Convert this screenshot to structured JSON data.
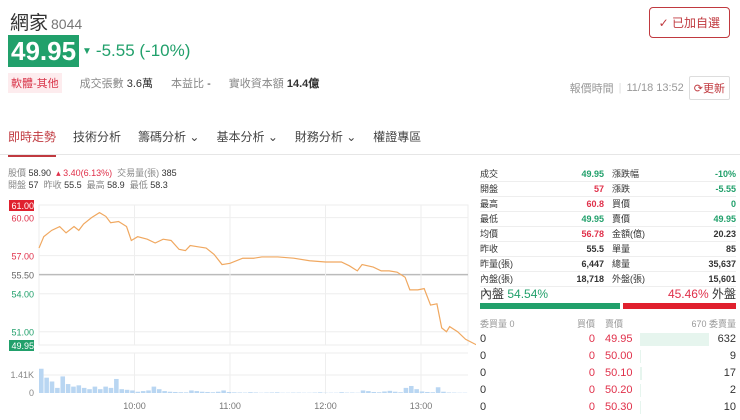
{
  "stock": {
    "name": "網家",
    "code": "8044",
    "price": "49.95",
    "change": "-5.55 (-10%)",
    "category": "軟體-其他",
    "stats": [
      {
        "label": "成交張數",
        "value": "3.6萬"
      },
      {
        "label": "本益比",
        "value": "-"
      },
      {
        "label": "實收資本額",
        "value": "14.4億"
      }
    ]
  },
  "header": {
    "favorite_label": "已加自選",
    "quote_time_label": "報價時間",
    "quote_time": "11/18 13:52",
    "refresh_label": "更新"
  },
  "tabs": [
    "即時走勢",
    "技術分析",
    "籌碼分析",
    "基本分析",
    "財務分析",
    "權證專區"
  ],
  "info": {
    "price_label": "股價",
    "price": "58.90",
    "change": "3.40(6.13%)",
    "vol_label": "交易量(張)",
    "vol": "385",
    "open_label": "開盤",
    "open": "57",
    "prev_label": "昨收",
    "prev": "55.5",
    "high_label": "最高",
    "high": "58.9",
    "low_label": "最低",
    "low": "58.3"
  },
  "table": [
    [
      {
        "l": "成交",
        "v": "49.95",
        "c": "green"
      },
      {
        "l": "漲跌幅",
        "v": "-10%",
        "c": "green"
      }
    ],
    [
      {
        "l": "開盤",
        "v": "57",
        "c": "red"
      },
      {
        "l": "漲跌",
        "v": "-5.55",
        "c": "green"
      }
    ],
    [
      {
        "l": "最高",
        "v": "60.8",
        "c": "red"
      },
      {
        "l": "買價",
        "v": "0",
        "c": "green"
      }
    ],
    [
      {
        "l": "最低",
        "v": "49.95",
        "c": "green"
      },
      {
        "l": "賣價",
        "v": "49.95",
        "c": "green"
      }
    ],
    [
      {
        "l": "均價",
        "v": "56.78",
        "c": "red"
      },
      {
        "l": "金額(億)",
        "v": "20.23",
        "c": ""
      }
    ],
    [
      {
        "l": "昨收",
        "v": "55.5",
        "c": ""
      },
      {
        "l": "單量",
        "v": "85",
        "c": ""
      }
    ],
    [
      {
        "l": "昨量(張)",
        "v": "6,447",
        "c": ""
      },
      {
        "l": "總量",
        "v": "35,637",
        "c": ""
      }
    ],
    [
      {
        "l": "內盤(張)",
        "v": "18,718",
        "c": ""
      },
      {
        "l": "外盤(張)",
        "v": "15,601",
        "c": ""
      }
    ]
  ],
  "ratio": {
    "inner_label": "內盤",
    "inner": "54.54%",
    "outer": "45.46%",
    "outer_label": "外盤",
    "inner_frac": 0.5454
  },
  "orderbook": {
    "bid_vol_header": "委買量 0",
    "bid_header": "買價",
    "ask_header": "賣價",
    "ask_vol_header": "670 委賣量",
    "rows": [
      [
        "0",
        "0",
        "49.95",
        "632"
      ],
      [
        "0",
        "0",
        "50.00",
        "9"
      ],
      [
        "0",
        "0",
        "50.10",
        "17"
      ],
      [
        "0",
        "0",
        "50.20",
        "2"
      ],
      [
        "0",
        "0",
        "50.30",
        "10"
      ]
    ]
  },
  "chart_data": {
    "type": "line",
    "ylim": [
      49.95,
      61.0
    ],
    "prev_close": 55.5,
    "y_ticks": [
      "61.00",
      "60.00",
      "57.00",
      "55.50",
      "54.00",
      "51.00",
      "49.95"
    ],
    "y_tick_values": [
      61,
      60,
      57,
      55.5,
      54,
      51,
      49.95
    ],
    "x_ticks": [
      "10:00",
      "11:00",
      "12:00",
      "13:00"
    ],
    "x_tick_minutes": [
      60,
      120,
      180,
      240
    ],
    "minutes": [
      0,
      3,
      8,
      13,
      17,
      22,
      25,
      28,
      33,
      38,
      42,
      45,
      50,
      55,
      58,
      62,
      68,
      73,
      78,
      83,
      88,
      92,
      95,
      100,
      105,
      110,
      115,
      120,
      128,
      135,
      140,
      145,
      150,
      160,
      170,
      180,
      190,
      195,
      200,
      203,
      210,
      215,
      220,
      225,
      230,
      233,
      238,
      242,
      246,
      250,
      253,
      256,
      258,
      263,
      268,
      275,
      300
    ],
    "prices": [
      57.6,
      58.5,
      59.0,
      59.3,
      58.8,
      59.3,
      59.0,
      59.5,
      60.0,
      60.4,
      60.1,
      59.6,
      59.7,
      59.3,
      58.2,
      58.5,
      58.3,
      58.0,
      58.3,
      58.2,
      57.5,
      57.4,
      57.8,
      57.7,
      57.6,
      57.1,
      56.3,
      56.4,
      56.8,
      56.8,
      56.9,
      56.9,
      56.9,
      56.8,
      56.6,
      56.5,
      56.5,
      56.2,
      55.8,
      56.3,
      56.1,
      55.8,
      55.8,
      55.7,
      55.3,
      54.3,
      54.3,
      54.4,
      53.1,
      53.2,
      51.3,
      51.0,
      51.4,
      51.0,
      50.4,
      49.95,
      49.95
    ],
    "volume_ticks": [
      "1.41K",
      "0"
    ],
    "volume_max": 2000,
    "volumes": [
      1900,
      1200,
      900,
      400,
      1300,
      700,
      500,
      600,
      400,
      300,
      500,
      300,
      500,
      400,
      1100,
      300,
      250,
      200,
      100,
      150,
      200,
      500,
      300,
      150,
      100,
      80,
      60,
      50,
      200,
      150,
      100,
      80,
      60,
      100,
      200,
      80,
      50,
      40,
      30,
      60,
      40,
      20,
      30,
      40,
      50,
      20,
      20,
      30,
      30,
      20,
      20,
      30,
      50,
      20,
      20,
      20,
      60,
      30,
      30,
      20,
      200,
      150,
      80,
      60,
      120,
      170,
      100,
      60,
      400,
      550,
      300,
      120,
      80,
      60,
      450,
      100,
      40,
      30,
      20,
      20
    ]
  }
}
